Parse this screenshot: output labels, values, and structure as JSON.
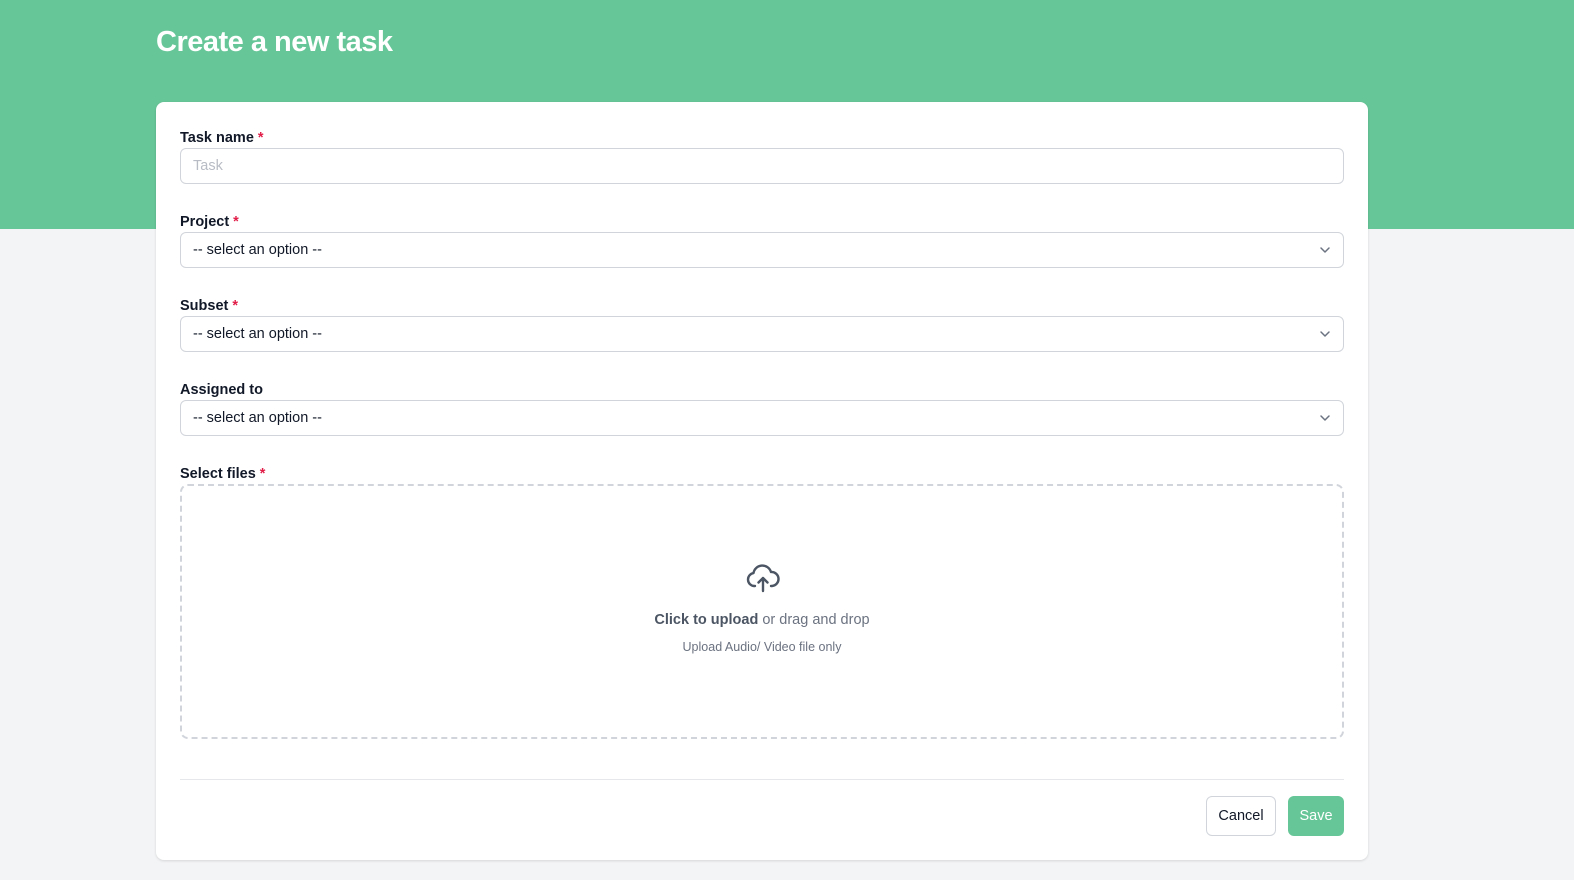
{
  "header": {
    "title": "Create a new task"
  },
  "form": {
    "task_name": {
      "label": "Task name",
      "required_mark": "*",
      "placeholder": "Task",
      "value": ""
    },
    "project": {
      "label": "Project",
      "required_mark": "*",
      "selected": "-- select an option --"
    },
    "subset": {
      "label": "Subset",
      "required_mark": "*",
      "selected": "-- select an option --"
    },
    "assigned_to": {
      "label": "Assigned to",
      "selected": "-- select an option --"
    },
    "files": {
      "label": "Select files",
      "required_mark": "*",
      "upload_action": "Click to upload",
      "upload_rest": " or drag and drop",
      "hint": "Upload Audio/ Video file only",
      "icon": "cloud-upload-icon"
    }
  },
  "actions": {
    "cancel_label": "Cancel",
    "save_label": "Save"
  },
  "colors": {
    "brand": "#67c698",
    "required": "#e11d48",
    "page_background": "#f3f4f6"
  }
}
